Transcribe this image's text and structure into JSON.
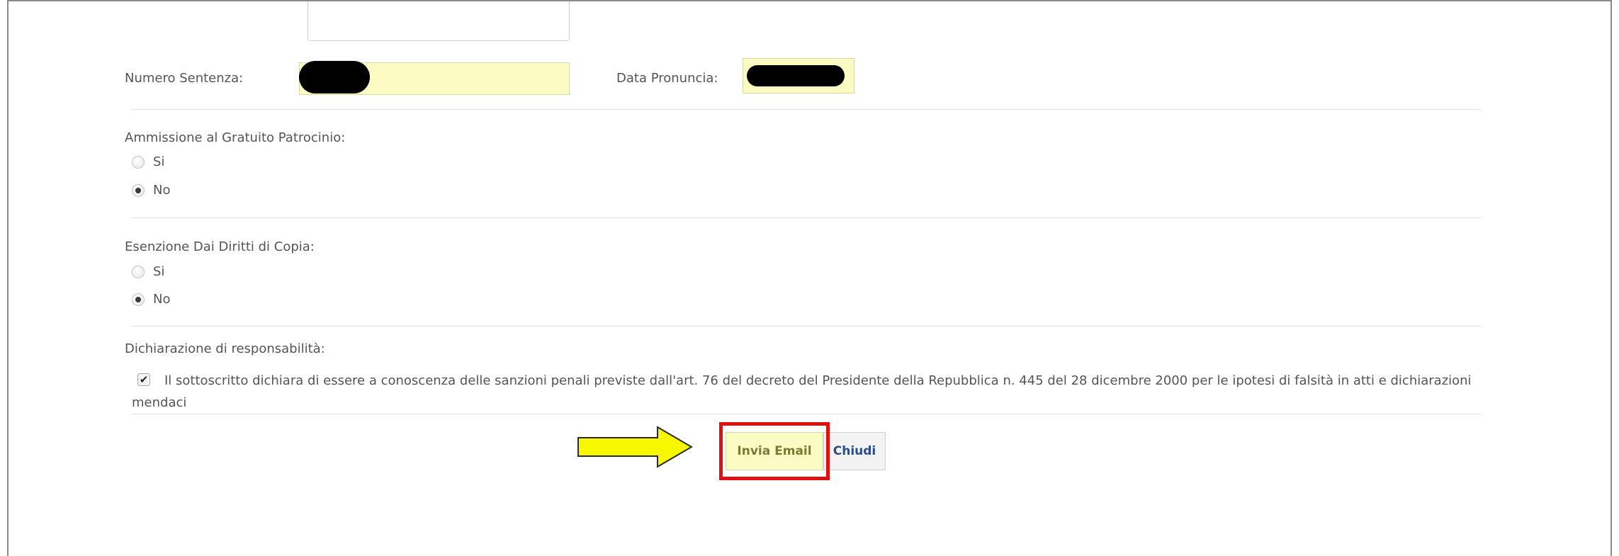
{
  "form": {
    "numero_sentenza_label": "Numero Sentenza:",
    "data_pronuncia_label": "Data Pronuncia:",
    "gratuito_patrocinio": {
      "label": "Ammissione al Gratuito Patrocinio:",
      "options": [
        "Si",
        "No"
      ],
      "selected": "No"
    },
    "esenzione_diritti": {
      "label": "Esenzione Dai Diritti di Copia:",
      "options": [
        "Si",
        "No"
      ],
      "selected": "No"
    },
    "dichiarazione": {
      "label": "Dichiarazione di responsabilità:",
      "checked": true,
      "text": "Il sottoscritto dichiara di essere a conoscenza delle sanzioni penali previste dall'art. 76 del decreto del Presidente della Repubblica n. 445 del 28 dicembre 2000 per le ipotesi di falsità in atti e dichiarazioni mendaci"
    }
  },
  "actions": {
    "send_label": "Invia Email",
    "close_label": "Chiudi"
  },
  "annotation": {
    "arrow_color": "#f7f700",
    "highlight_color": "#e01010"
  }
}
